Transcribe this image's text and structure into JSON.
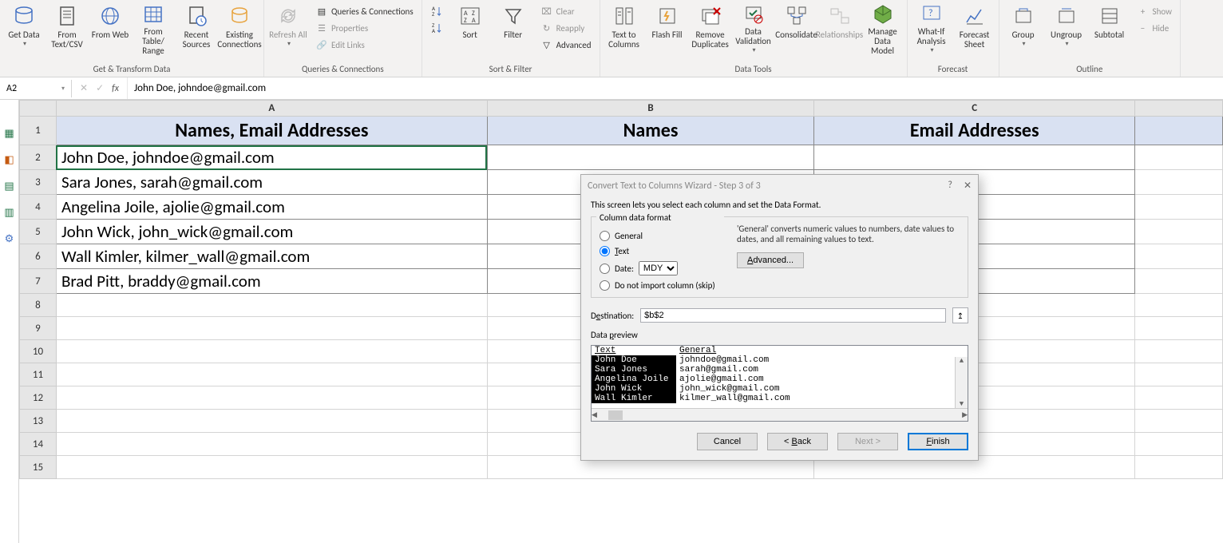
{
  "ribbon": {
    "groups": [
      {
        "label": "Get & Transform Data",
        "buttons": [
          "Get Data",
          "From Text/CSV",
          "From Web",
          "From Table/ Range",
          "Recent Sources",
          "Existing Connections"
        ]
      },
      {
        "label": "Queries & Connections",
        "large": [
          "Refresh All"
        ],
        "small": [
          "Queries & Connections",
          "Properties",
          "Edit Links"
        ]
      },
      {
        "label": "Sort & Filter",
        "large": [
          "Sort",
          "Filter"
        ],
        "small": [
          "Clear",
          "Reapply",
          "Advanced"
        ]
      },
      {
        "label": "Data Tools",
        "buttons": [
          "Text to Columns",
          "Flash Fill",
          "Remove Duplicates",
          "Data Validation",
          "Consolidate",
          "Relationships",
          "Manage Data Model"
        ]
      },
      {
        "label": "Forecast",
        "buttons": [
          "What-If Analysis",
          "Forecast Sheet"
        ]
      },
      {
        "label": "Outline",
        "buttons": [
          "Group",
          "Ungroup",
          "Subtotal"
        ],
        "small": [
          "Show",
          "Hide"
        ]
      }
    ]
  },
  "formula_bar": {
    "cell_ref": "A2",
    "formula": "John Doe, johndoe@gmail.com"
  },
  "columns": [
    "A",
    "B",
    "C",
    ""
  ],
  "header_row": [
    "Names, Email Addresses",
    "Names",
    "Email Addresses"
  ],
  "data_rows": [
    "John Doe, johndoe@gmail.com",
    "Sara Jones, sarah@gmail.com",
    "Angelina Joile, ajolie@gmail.com",
    "John Wick, john_wick@gmail.com",
    "Wall Kimler, kilmer_wall@gmail.com",
    "Brad Pitt, braddy@gmail.com"
  ],
  "dialog": {
    "title": "Convert Text to Columns Wizard - Step 3 of 3",
    "desc": "This screen lets you select each column and set the Data Format.",
    "fieldset_label": "Column data format",
    "radios": {
      "general": "General",
      "text": "Text",
      "date": "Date:",
      "date_format": "MDY",
      "skip": "Do not import column (skip)"
    },
    "general_note": "'General' converts numeric values to numbers, date values to dates, and all remaining values to text.",
    "advanced": "Advanced...",
    "destination_label": "Destination:",
    "destination_value": "$b$2",
    "preview_label": "Data preview",
    "preview_headers": [
      "Text",
      "General"
    ],
    "preview_rows": [
      [
        "John Doe",
        "johndoe@gmail.com"
      ],
      [
        "Sara Jones",
        "sarah@gmail.com"
      ],
      [
        "Angelina Joile",
        "ajolie@gmail.com"
      ],
      [
        "John Wick",
        "john_wick@gmail.com"
      ],
      [
        "Wall Kimler",
        "kilmer_wall@gmail.com"
      ]
    ],
    "buttons": {
      "cancel": "Cancel",
      "back": "< Back",
      "next": "Next >",
      "finish": "Finish"
    }
  }
}
